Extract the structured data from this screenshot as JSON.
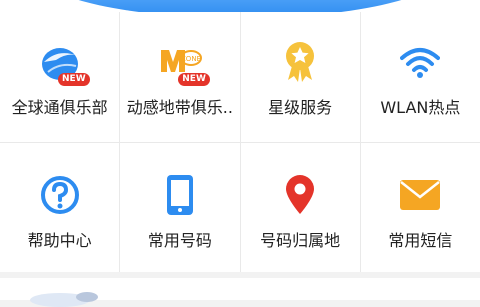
{
  "colors": {
    "blue": "#2d8cf0",
    "yellow": "#f6c23c",
    "red": "#e4342a",
    "orange": "#f5a623"
  },
  "grid": {
    "items": [
      {
        "id": "global",
        "label": "全球通俱乐部",
        "icon": "globe-icon",
        "badge": "NEW"
      },
      {
        "id": "dongganzone",
        "label": "动感地带俱乐..",
        "icon": "mzone-icon",
        "badge": "NEW"
      },
      {
        "id": "star",
        "label": "星级服务",
        "icon": "star-medal-icon"
      },
      {
        "id": "wlan",
        "label": "WLAN热点",
        "icon": "wifi-icon"
      },
      {
        "id": "help",
        "label": "帮助中心",
        "icon": "help-icon"
      },
      {
        "id": "phone",
        "label": "常用号码",
        "icon": "phone-icon"
      },
      {
        "id": "location",
        "label": "号码归属地",
        "icon": "location-pin-icon"
      },
      {
        "id": "sms",
        "label": "常用短信",
        "icon": "envelope-icon"
      }
    ]
  }
}
